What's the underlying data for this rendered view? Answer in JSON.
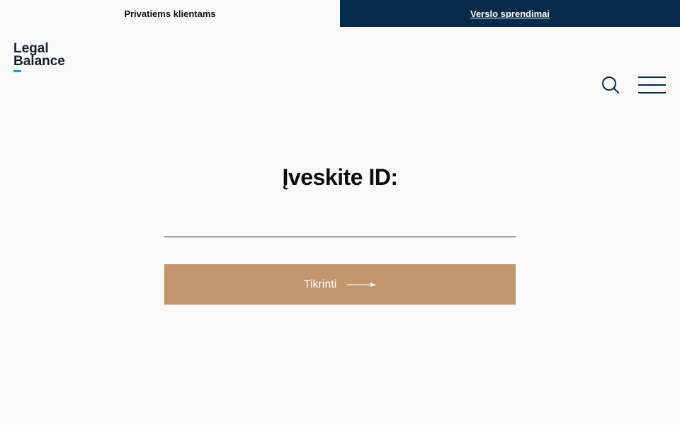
{
  "topbar": {
    "private_label": "Privatiems klientams",
    "business_label": "Verslo sprendimai"
  },
  "header": {
    "logo_line1": "Legal",
    "logo_line2": "Balance",
    "search_icon": "search-icon",
    "menu_icon": "hamburger-menu-icon"
  },
  "main": {
    "title": "Įveskite ID:",
    "input_value": "",
    "button_label": "Tikrinti",
    "button_icon": "arrow-right-icon"
  },
  "colors": {
    "navy": "#072b4a",
    "accent_blue": "#1f9bd3",
    "button_tan": "#c2966d",
    "background": "#f9f9f9"
  }
}
